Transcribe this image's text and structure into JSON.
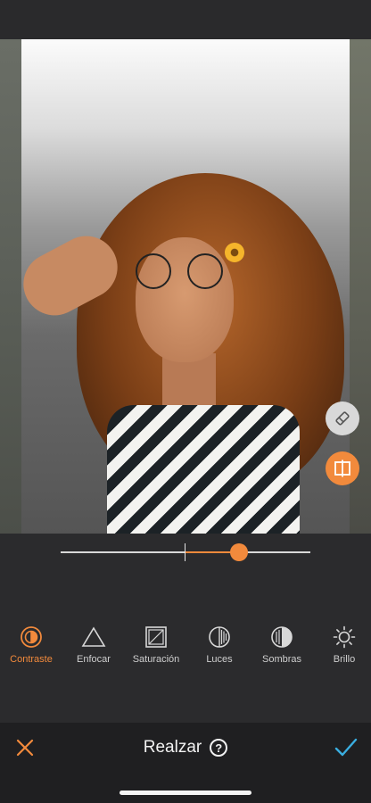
{
  "colors": {
    "accent": "#f28a3c",
    "confirm": "#3aaee0",
    "background": "#2b2b2d"
  },
  "slider": {
    "min": -100,
    "max": 100,
    "value": 43
  },
  "tools": [
    {
      "label": "Contraste",
      "icon": "contrast-icon",
      "active": true
    },
    {
      "label": "Enfocar",
      "icon": "sharpen-triangle-icon",
      "active": false
    },
    {
      "label": "Saturación",
      "icon": "saturation-icon",
      "active": false
    },
    {
      "label": "Luces",
      "icon": "highlights-icon",
      "active": false
    },
    {
      "label": "Sombras",
      "icon": "shadows-icon",
      "active": false
    },
    {
      "label": "Brillo",
      "icon": "brightness-sun-icon",
      "active": false
    }
  ],
  "bottom_bar": {
    "title": "Realzar",
    "help": "?"
  }
}
